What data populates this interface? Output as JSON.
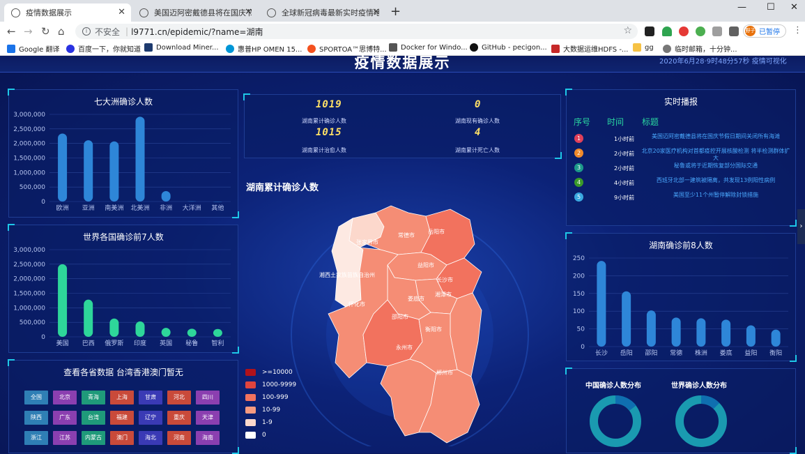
{
  "browser": {
    "tabs": [
      {
        "label": "疫情数据展示",
        "active": true
      },
      {
        "label": "美国迈阿密戴德县将在国庆节假日...",
        "active": false
      },
      {
        "label": "全球新冠病毒最新实时疫情地图...",
        "active": false
      }
    ],
    "url_security": "不安全",
    "url": "l9771.cn/epidemic/?name=湖南",
    "pause_label": "已暂停",
    "avatar_text": "野子",
    "bookmarks": [
      "Google 翻译",
      "百度一下，你就知道",
      "Download Miner...",
      "惠普HP OMEN 15...",
      "SPORTOA™思博特...",
      "Docker for Windo...",
      "GitHub - pecigon...",
      "大数据运维HDFS -...",
      "gg",
      "临时邮箱，十分钟..."
    ]
  },
  "page": {
    "title": "疫情数据展示",
    "datetime": "2020年6月28·9时48分57秒",
    "datetime_link": "疫情可视化"
  },
  "continents": {
    "title": "七大洲确诊人数",
    "yticks": [
      "3,000,000",
      "2,500,000",
      "2,000,000",
      "1,500,000",
      "1,000,000",
      "500,000",
      "0"
    ]
  },
  "countries": {
    "title": "世界各国确诊前7人数",
    "yticks": [
      "3,000,000",
      "2,500,000",
      "2,000,000",
      "1,500,000",
      "1,000,000",
      "500,000",
      "0"
    ]
  },
  "provinces": {
    "title": "查看各省数据 台湾香港澳门暂无",
    "buttons": [
      {
        "label": "全国",
        "color": "#2f7fb5"
      },
      {
        "label": "北京",
        "color": "#8b3fb0"
      },
      {
        "label": "青海",
        "color": "#1f9a7a"
      },
      {
        "label": "上海",
        "color": "#c94a3a"
      },
      {
        "label": "甘肃",
        "color": "#3a3ab5"
      },
      {
        "label": "河北",
        "color": "#c94a3a"
      },
      {
        "label": "四川",
        "color": "#8b3fb0"
      },
      {
        "label": "陕西",
        "color": "#2f7fb5"
      },
      {
        "label": "广东",
        "color": "#8b3fb0"
      },
      {
        "label": "台湾",
        "color": "#1f9a7a"
      },
      {
        "label": "福建",
        "color": "#c94a3a"
      },
      {
        "label": "辽宁",
        "color": "#3a3ab5"
      },
      {
        "label": "重庆",
        "color": "#c94a3a"
      },
      {
        "label": "天津",
        "color": "#8b3fb0"
      },
      {
        "label": "浙江",
        "color": "#2f7fb5"
      },
      {
        "label": "江苏",
        "color": "#8b3fb0"
      },
      {
        "label": "内蒙古",
        "color": "#1f9a7a"
      },
      {
        "label": "澳门",
        "color": "#c94a3a"
      },
      {
        "label": "海北",
        "color": "#3a3ab5"
      },
      {
        "label": "河南",
        "color": "#c94a3a"
      },
      {
        "label": "海南",
        "color": "#8b3fb0"
      }
    ]
  },
  "stats": [
    {
      "value": "1019",
      "label": "湖南累计确诊人数"
    },
    {
      "value": "0",
      "label": "湖南现有确诊人数"
    },
    {
      "value": "1015",
      "label": "湖南累计治愈人数"
    },
    {
      "value": "4",
      "label": "湖南累计死亡人数"
    }
  ],
  "map": {
    "title": "湖南累计确诊人数",
    "cities": [
      "岳阳市",
      "常德市",
      "益阳市",
      "长沙市",
      "湘西土家族苗族自治州",
      "张家界市",
      "湘潭市",
      "娄底市",
      "怀化市",
      "邵阳市",
      "衡阳市",
      "永州市",
      "郴州市"
    ],
    "legend": [
      {
        "label": ">=10000",
        "color": "#b0121b"
      },
      {
        "label": "1000-9999",
        "color": "#e0443e"
      },
      {
        "label": "100-999",
        "color": "#f2725e"
      },
      {
        "label": "10-99",
        "color": "#f79a80"
      },
      {
        "label": "1-9",
        "color": "#fcd8cc"
      },
      {
        "label": "0",
        "color": "#ffffff"
      }
    ]
  },
  "news": {
    "title": "实时播报",
    "headers": [
      "序号",
      "时间",
      "标题"
    ],
    "items": [
      {
        "num": "1",
        "color": "#e0405a",
        "time": "1小时前",
        "text": "美国迈阿密戴德县将在国庆节假日期间关闭所有海滩"
      },
      {
        "num": "2",
        "color": "#f08a2a",
        "time": "2小时前",
        "text": "北京20家医疗机构对首都疫控开展核酸检测 将半检测群体扩大"
      },
      {
        "num": "3",
        "color": "#1d9a8a",
        "time": "2小时前",
        "text": "秘鲁或将于近期恢复部分国际交通"
      },
      {
        "num": "4",
        "color": "#3a9a2a",
        "time": "4小时前",
        "text": "西班牙北部一建筑被隔离，共发现13例阳性病例"
      },
      {
        "num": "5",
        "color": "#3aa8e0",
        "time": "9小时前",
        "text": "美国至少11个州暂停解除封锁措施"
      }
    ]
  },
  "hunan_top8": {
    "title": "湖南确诊前8人数",
    "yticks": [
      "250",
      "200",
      "150",
      "100",
      "50",
      "0"
    ]
  },
  "distribution": {
    "china_title": "中国确诊人数分布",
    "world_title": "世界确诊人数分布"
  },
  "chart_data": [
    {
      "type": "bar",
      "title": "七大洲确诊人数",
      "categories": [
        "欧洲",
        "亚洲",
        "南美洲",
        "北美洲",
        "非洲",
        "大洋洲",
        "其他"
      ],
      "values": [
        2340000,
        2110000,
        2070000,
        2920000,
        360000,
        9000,
        700
      ],
      "ylim": [
        0,
        3000000
      ]
    },
    {
      "type": "bar",
      "title": "世界各国确诊前7人数",
      "categories": [
        "美国",
        "巴西",
        "俄罗斯",
        "印度",
        "英国",
        "秘鲁",
        "智利"
      ],
      "values": [
        2500000,
        1280000,
        630000,
        530000,
        310000,
        280000,
        270000
      ],
      "ylim": [
        0,
        3000000
      ]
    },
    {
      "type": "bar",
      "title": "湖南确诊前8人数",
      "categories": [
        "长沙",
        "岳阳",
        "邵阳",
        "常德",
        "株洲",
        "娄底",
        "益阳",
        "衡阳"
      ],
      "values": [
        242,
        156,
        102,
        82,
        80,
        76,
        60,
        48
      ],
      "ylim": [
        0,
        250
      ]
    }
  ]
}
